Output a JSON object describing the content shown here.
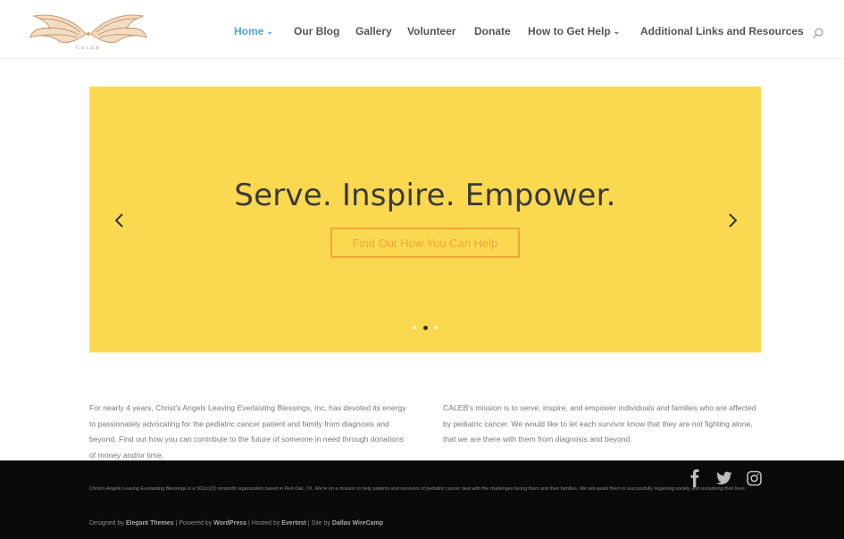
{
  "header": {
    "logo_alt": "CALEB",
    "nav": [
      {
        "label": "Home",
        "has_caret": true,
        "active": true
      },
      {
        "label": "Our Blog",
        "has_caret": false,
        "active": false
      },
      {
        "label": "Gallery",
        "has_caret": false,
        "active": false
      },
      {
        "label": "Volunteer",
        "has_caret": false,
        "active": false
      },
      {
        "label": "Donate",
        "has_caret": false,
        "active": false
      },
      {
        "label": "How to Get Help",
        "has_caret": true,
        "active": false
      },
      {
        "label": "Additional Links and Resources",
        "has_caret": false,
        "active": false
      }
    ],
    "search_icon": "search-icon"
  },
  "slider": {
    "title": "Serve. Inspire. Empower.",
    "cta_label": "Find Out How You Can Help",
    "background_color": "#fad950",
    "accent_color": "#f2a53b",
    "slide_count": 3,
    "active_slide": 2
  },
  "content": {
    "left": "For nearly 4 years, Christ's Angels Leaving Everlasting Blessings, Inc. has devoted its energy to passionately advocating for the pediatric cancer patient and family from diagnosis and beyond. Find out how you can contribute to the future of someone in need through donations of money and/or time.",
    "right": "CALEB's mission is to serve, inspire, and empower individuals and families who are affected by pediatric cancer. We would like to let each survivor know that they are not fighting alone, that we are there with them from diagnosis and beyond."
  },
  "footer": {
    "about": "Christ's Angels Leaving Everlasting Blessings is a 501(c)(3) nonprofit organization based in Red Oak, TX. We're on a mission to help patients and survivors of pediatric cancer deal with the challenges facing them and their families. We will assist them in successfully regaining society and reclaiming their lives.",
    "credits": {
      "designed_prefix": "Designed by ",
      "designed_by": "Elegant Themes",
      "powered_prefix": " | Powered by ",
      "powered_by": "WordPress",
      "hosted_prefix": " | Hosted by ",
      "hosted_by": "Evertest",
      "site_prefix": " | Site by ",
      "site_by": "Dallas WireCamp"
    },
    "social": [
      "facebook-icon",
      "twitter-icon",
      "instagram-icon"
    ]
  }
}
